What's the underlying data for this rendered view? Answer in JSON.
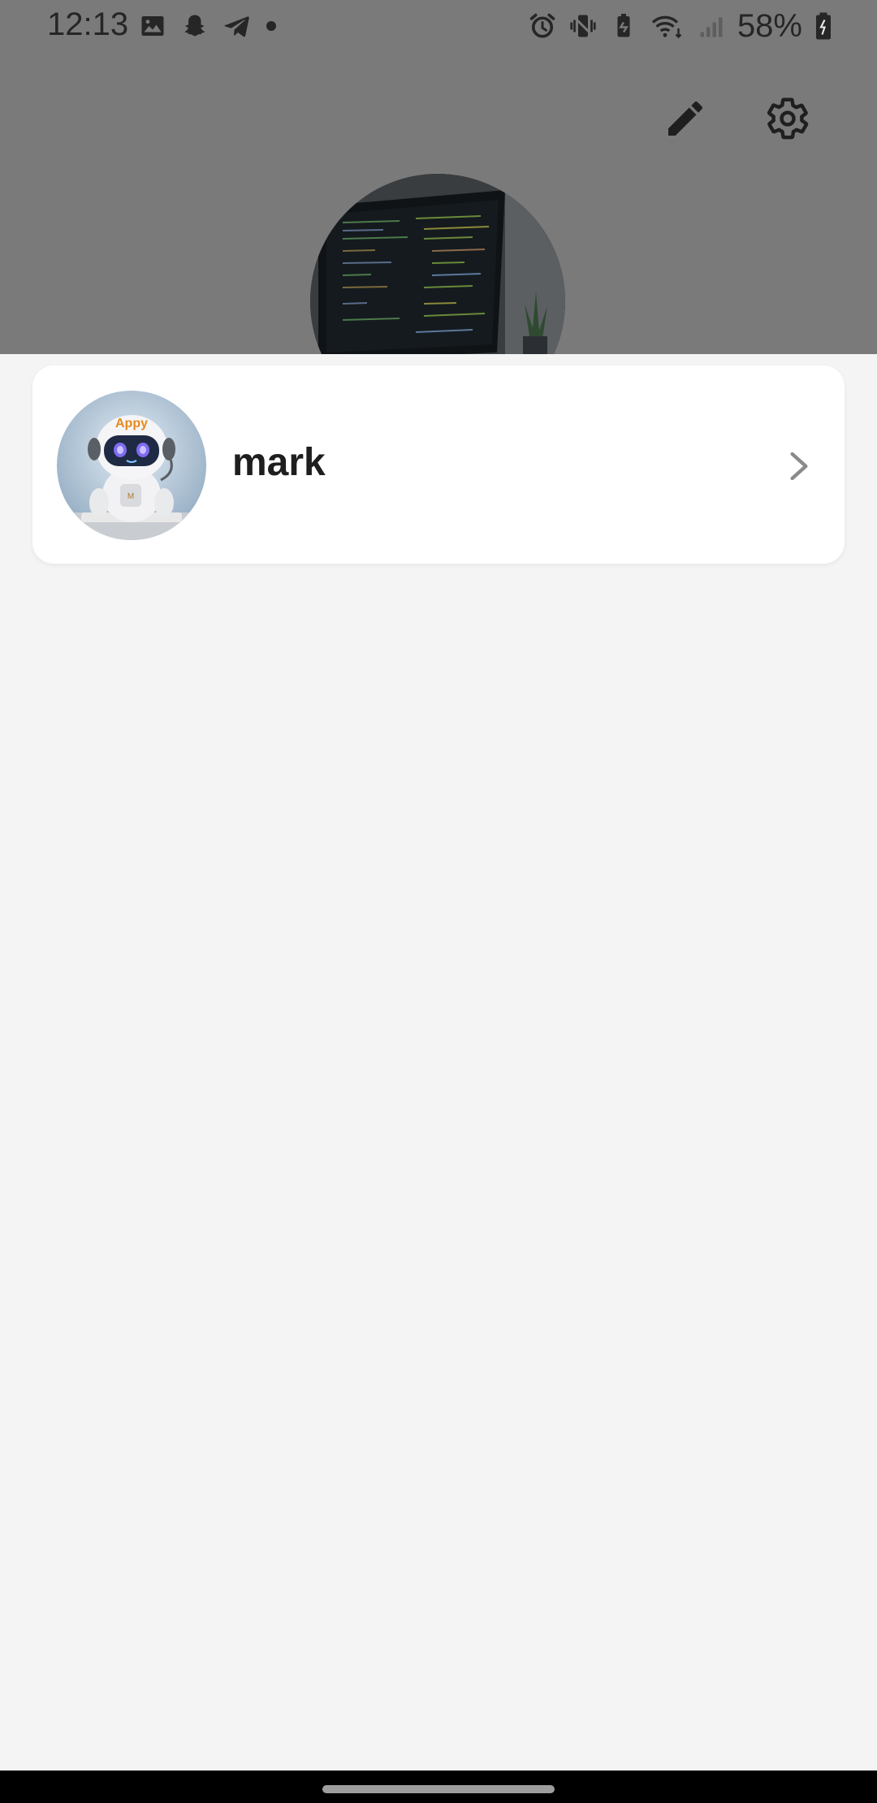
{
  "status_bar": {
    "time": "12:13",
    "battery": "58%",
    "left_icons": [
      "gallery-icon",
      "snapchat-icon",
      "telegram-icon",
      "dot-icon"
    ],
    "right_icons": [
      "alarm-icon",
      "vibrate-icon",
      "battery-saver-icon",
      "wifi-icon",
      "signal-icon",
      "battery-icon"
    ]
  },
  "header": {
    "actions": [
      "edit-icon",
      "settings-icon"
    ],
    "cover_photo": "code-editor-laptop-photo"
  },
  "profile_list": [
    {
      "name": "mark",
      "avatar": "robot-avatar",
      "avatar_badge": "Appy"
    }
  ],
  "colors": {
    "dim_overlay": "#7a7a7a",
    "sheet_bg": "#f4f4f4",
    "card_bg": "#ffffff",
    "text_primary": "#1e1e1e",
    "chevron": "#8a8a8a"
  }
}
